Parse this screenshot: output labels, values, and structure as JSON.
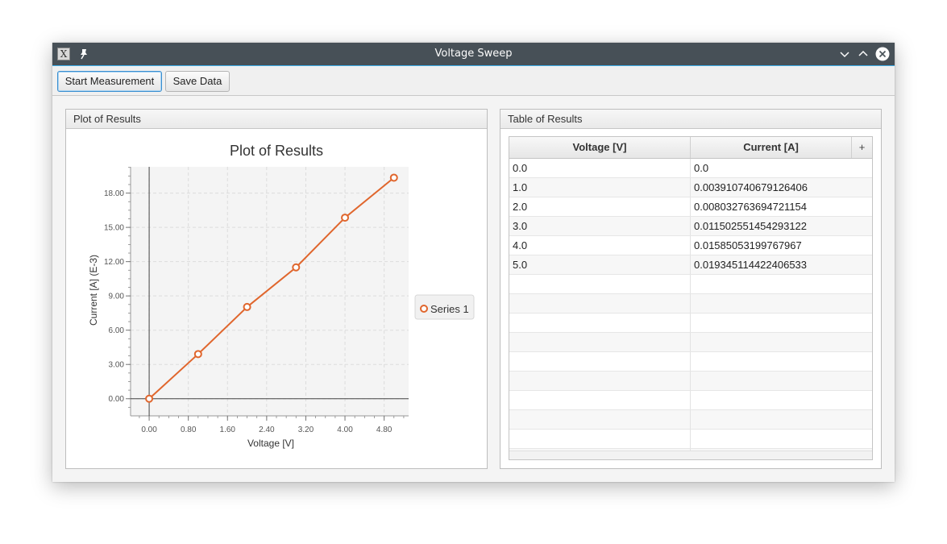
{
  "window": {
    "title": "Voltage Sweep",
    "app_icon": "x-app-icon",
    "app_icon_glyph": "X",
    "accent": "#3daee9"
  },
  "toolbar": {
    "start_label": "Start Measurement",
    "save_label": "Save Data"
  },
  "plot_panel": {
    "header": "Plot of Results"
  },
  "table_panel": {
    "header": "Table of Results",
    "columns": [
      "Voltage [V]",
      "Current [A]"
    ],
    "column_menu_glyph": "+",
    "rows": [
      [
        "0.0",
        "0.0"
      ],
      [
        "1.0",
        "0.003910740679126406"
      ],
      [
        "2.0",
        "0.008032763694721154"
      ],
      [
        "3.0",
        "0.011502551454293122"
      ],
      [
        "4.0",
        "0.01585053199767967"
      ],
      [
        "5.0",
        "0.019345114422406533"
      ]
    ],
    "empty_rows": 10
  },
  "chart_data": {
    "type": "line",
    "title": "Plot of Results",
    "xlabel": "Voltage [V]",
    "ylabel": "Current [A] (E-3)",
    "xlim": [
      -0.38,
      5.3
    ],
    "ylim": [
      -1.5,
      20.3
    ],
    "x_ticks": [
      "0.00",
      "0.80",
      "1.60",
      "2.40",
      "3.20",
      "4.00",
      "4.80"
    ],
    "x_tick_values": [
      0,
      0.8,
      1.6,
      2.4,
      3.2,
      4.0,
      4.8
    ],
    "y_ticks": [
      "0.00",
      "3.00",
      "6.00",
      "9.00",
      "12.00",
      "15.00",
      "18.00"
    ],
    "y_tick_values": [
      0,
      3,
      6,
      9,
      12,
      15,
      18
    ],
    "grid": true,
    "legend_position": "right",
    "series": [
      {
        "name": "Series 1",
        "color": "#e0662d",
        "x": [
          0,
          1,
          2,
          3,
          4,
          5
        ],
        "y": [
          0,
          3.91,
          8.03,
          11.5,
          15.85,
          19.35
        ]
      }
    ]
  }
}
